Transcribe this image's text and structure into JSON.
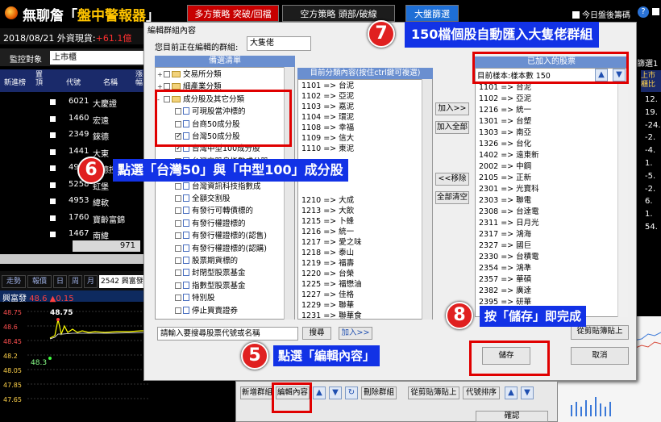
{
  "app": {
    "title_prefix": "無聊詹「",
    "title_main": "盤中警報器",
    "title_suffix": "」"
  },
  "top_buttons": {
    "short_strategy": "多方策略 突破/回檔",
    "empty_strategy": "空方策略 頭部/破線",
    "market_filter": "大盤篩選",
    "today_code": "今日盤後籌碼"
  },
  "left_panel": {
    "date": "2018/08/21",
    "cash_label": "外資現貨:",
    "cash_value": "+61.1億",
    "monitor_label": "監控對象",
    "monitor_value": "上市櫃",
    "headers": [
      "新進榜",
      "置頂",
      "代號",
      "名稱",
      "漲幅"
    ],
    "rows": [
      {
        "code": "6021",
        "name": "大慶證"
      },
      {
        "code": "1460",
        "name": "宏遠"
      },
      {
        "code": "2349",
        "name": "錸德"
      },
      {
        "code": "1441",
        "name": "大東"
      },
      {
        "code": "4912",
        "name": "聯德控..."
      },
      {
        "code": "5258",
        "name": "虹堡"
      },
      {
        "code": "4953",
        "name": "緯軟"
      },
      {
        "code": "1760",
        "name": "寶齡富錦"
      },
      {
        "code": "1467",
        "name": "南緯"
      }
    ],
    "scroll_value": "971",
    "tabs": [
      "走勢",
      "報價",
      "日",
      "周",
      "月"
    ],
    "stock_code": "2542 興富發",
    "chart_stock": "興富發",
    "chart_price": "48.6",
    "chart_change": "▲0.15",
    "chart_high": "48.75",
    "chart_low": "48.3",
    "y_ticks": [
      "48.75",
      "48.6",
      "48.45",
      "48.2",
      "48.05",
      "47.85",
      "47.65"
    ]
  },
  "dialog": {
    "title": "編輯群組內容",
    "group_label": "您目前正在編輯的群組:",
    "group_value": "大隻佬",
    "list_title": "備選清單",
    "tree": [
      {
        "label": "交易所分類",
        "type": "folder",
        "expand": "+"
      },
      {
        "label": "細產業分類",
        "type": "folder",
        "expand": "+"
      },
      {
        "label": "成分股及其它分類",
        "type": "folder",
        "expand": "-"
      },
      {
        "label": "可現股當沖標的",
        "type": "doc",
        "checked": false
      },
      {
        "label": "台商50成分股",
        "type": "doc",
        "checked": false
      },
      {
        "label": "台灣50成分股",
        "type": "doc",
        "checked": true
      },
      {
        "label": "台灣中型100成分股",
        "type": "doc",
        "checked": true
      },
      {
        "label": "台灣高股息指數成分股",
        "type": "doc",
        "checked": false
      },
      {
        "label": "台灣發達指數成分股",
        "type": "doc",
        "checked": false
      },
      {
        "label": "台灣資訊科技指數成",
        "type": "doc",
        "checked": false
      },
      {
        "label": "全額交割股",
        "type": "doc",
        "checked": false
      },
      {
        "label": "有發行可轉債標的",
        "type": "doc",
        "checked": false
      },
      {
        "label": "有發行權證標的",
        "type": "doc",
        "checked": false
      },
      {
        "label": "有發行權證標的(認售)",
        "type": "doc",
        "checked": false
      },
      {
        "label": "有發行權證標的(認購)",
        "type": "doc",
        "checked": false
      },
      {
        "label": "股票期貨標的",
        "type": "doc",
        "checked": false
      },
      {
        "label": "封閉型股票基金",
        "type": "doc",
        "checked": false
      },
      {
        "label": "指數型股票基金",
        "type": "doc",
        "checked": false
      },
      {
        "label": "特別股",
        "type": "doc",
        "checked": false
      },
      {
        "label": "停止買賣證券",
        "type": "doc",
        "checked": false
      }
    ],
    "sub_title": "目前分類內容(按住ctrl鍵可複選)",
    "sub_items": [
      "1101 => 台泥",
      "1102 => 亞泥",
      "1103 => 嘉泥",
      "1104 => 環泥",
      "1108 => 幸福",
      "1109 => 信大",
      "1110 => 東泥",
      "",
      "",
      "",
      "",
      "1210 => 大成",
      "1213 => 大飲",
      "1215 => 卜蜂",
      "1216 => 統一",
      "1217 => 愛之味",
      "1218 => 泰山",
      "1219 => 福壽",
      "1220 => 台榮",
      "1225 => 福懋油",
      "1227 => 佳格",
      "1229 => 聯華",
      "1231 => 聯華食"
    ],
    "add_btn": "加入>>",
    "add_all_btn": "加入全部",
    "remove_btn": "<<移除",
    "clear_all_btn": "全部清空",
    "added_title": "已加入的股票",
    "added_info": "目前樣本:樣本數 150",
    "added_items": [
      "1101 => 台泥",
      "1102 => 亞泥",
      "1216 => 統一",
      "1301 => 台塑",
      "1303 => 南亞",
      "1326 => 台化",
      "1402 => 遠東新",
      "2002 => 中鋼",
      "2105 => 正新",
      "2301 => 光寶科",
      "2303 => 聯電",
      "2308 => 台達電",
      "2311 => 日月光",
      "2317 => 鴻海",
      "2327 => 國巨",
      "2330 => 台積電",
      "2354 => 鴻準",
      "2357 => 華碩",
      "2382 => 廣達",
      "2395 => 研華"
    ],
    "search_placeholder": "請輸入要搜尋股票代號或名稱",
    "search_btn": "搜尋",
    "add_search_btn": "加入>>",
    "paste_btn": "從剪貼簿貼上",
    "save_btn": "儲存",
    "cancel_btn": "取消"
  },
  "bottom_toolbar": {
    "new_group": "新增群組",
    "edit_content": "編輯內容",
    "delete_group": "刪除群組",
    "paste_from": "從剪貼簿貼上",
    "sort_code": "代號排序",
    "confirm": "確認"
  },
  "right_panel": {
    "title_fragment": "篩選1",
    "col_fragment": "上市櫃比",
    "values": [
      "12.",
      "19.",
      "-24.",
      "-2.",
      "-4.",
      "1.",
      "-5.",
      "-2.",
      "6.",
      "1.",
      "54."
    ]
  },
  "callouts": {
    "step5": "點選「編輯內容」",
    "step6": "點選「台灣50」與「中型100」成分股",
    "step7": "150檔個股自動匯入大隻佬群組",
    "step8": "按「儲存」即完成",
    "n5": "5",
    "n6": "6",
    "n7": "7",
    "n8": "8"
  },
  "colors": {
    "accent_red": "#e00000",
    "callout_blue": "#1232e6",
    "list_header": "#6a8fd0"
  }
}
